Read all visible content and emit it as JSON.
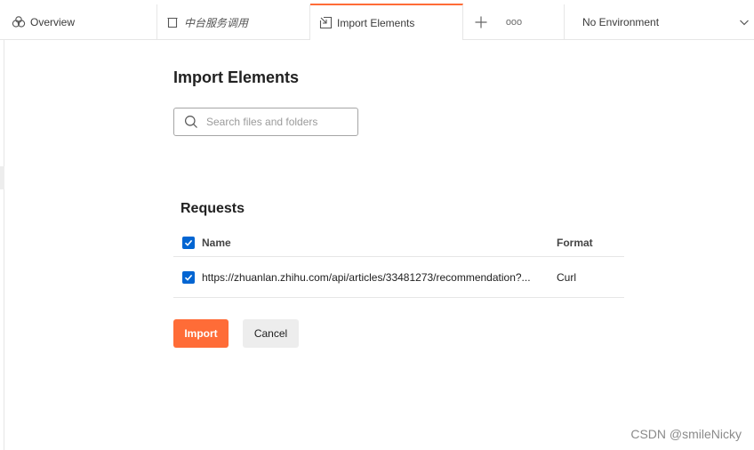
{
  "tabs": {
    "overview": {
      "label": "Overview",
      "icon": "overview-icon"
    },
    "collection": {
      "label": "中台服务调用",
      "icon": "collection-icon"
    },
    "import": {
      "label": "Import Elements",
      "icon": "import-icon",
      "accent": "#ff6c37"
    },
    "add_icon": "plus-icon",
    "more_icon": "more-icon",
    "more_glyph": "ooo"
  },
  "environment": {
    "selected": "No Environment",
    "icon": "chevron-down-icon"
  },
  "main": {
    "title": "Import Elements",
    "search": {
      "placeholder": "Search files and folders",
      "value": ""
    },
    "section_title": "Requests",
    "table": {
      "columns": [
        "Name",
        "Format"
      ],
      "rows": [
        {
          "name": "https://zhuanlan.zhihu.com/api/articles/33481273/recommendation?...",
          "format": "Curl",
          "checked": true
        }
      ],
      "header_checked": true
    },
    "buttons": {
      "import": "Import",
      "cancel": "Cancel"
    }
  },
  "colors": {
    "accent": "#ff6c37",
    "checkbox": "#0265d2"
  },
  "watermark": "CSDN @smileNicky"
}
